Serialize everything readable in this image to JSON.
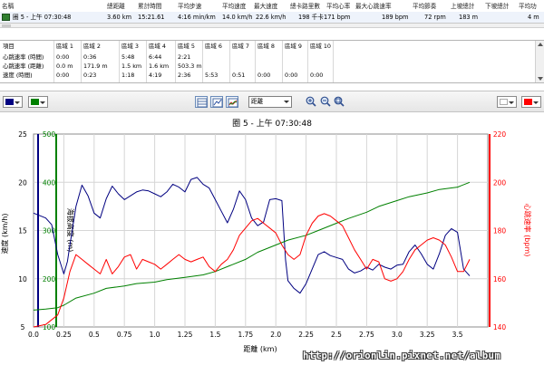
{
  "laps_table": {
    "headers": [
      "名稱",
      "總距離",
      "累計時間",
      "平均步速",
      "平均速度",
      "最大速度",
      "總卡路里數",
      "平均心率",
      "最大心跳速率",
      "平均節奏",
      "上坡總計",
      "平均功"
    ],
    "row": [
      "圈 5 - 上午 07:30:48",
      "3.60 km",
      "15:21.61",
      "4:16 min/km",
      "14.0 km/h",
      "22.6 km/h",
      "198 千卡",
      "171 bpm",
      "189 bpm",
      "72 rpm",
      "183 m",
      "4 m"
    ],
    "extra_header": "下坡總計"
  },
  "zones_table": {
    "headers": [
      "項目",
      "區域 1",
      "區域 2",
      "區域 3",
      "區域 4",
      "區域 5",
      "區域 6",
      "區域 7",
      "區域 8",
      "區域 9",
      "區域 10"
    ],
    "rows": [
      [
        "心跳速率 (時間)",
        "0:00",
        "0:36",
        "5:48",
        "6:44",
        "2:21",
        "",
        "",
        "",
        "",
        ""
      ],
      [
        "心跳速率 (距離)",
        "0.0 m",
        "171.9 m",
        "1.5 km",
        "1.6 km",
        "503.3 m",
        "",
        "",
        "",
        "",
        ""
      ],
      [
        "速度 (時間)",
        "0:00",
        "0:23",
        "1:18",
        "4:19",
        "2:36",
        "5:53",
        "0:51",
        "0:00",
        "0:00",
        "0:00"
      ]
    ]
  },
  "toolbar": {
    "left_color_1": "#000080",
    "left_color_2": "#008000",
    "x_axis_select": "距離",
    "right_color_1": "#ffffff",
    "right_color_2": "#ff0000",
    "icons": [
      "chart-view-icon",
      "line-view-icon",
      "combined-view-icon",
      "zoom-in-icon",
      "zoom-out-icon",
      "zoom-reset-icon"
    ]
  },
  "watermark": "http://orionlin.pixnet.net/album",
  "chart_data": {
    "type": "line",
    "title": "圈 5 - 上午 07:30:48",
    "xlabel": "距離 (km)",
    "x_ticks": [
      "0.0",
      "0.25",
      "0.5",
      "0.75",
      "1.0",
      "1.25",
      "1.5",
      "1.75",
      "2.0",
      "2.25",
      "2.5",
      "2.75",
      "3.0",
      "3.25",
      "3.5"
    ],
    "xlim": [
      0,
      3.75
    ],
    "axes": {
      "speed": {
        "label": "速度 (km/h)",
        "ticks": [
          5,
          10,
          15,
          20,
          25
        ],
        "ylim": [
          5,
          25
        ],
        "color": "#000080"
      },
      "elevation": {
        "label": "海拔高度 (m)",
        "ticks": [
          100,
          200,
          300,
          400,
          500
        ],
        "ylim": [
          100,
          500
        ],
        "color": "#008000"
      },
      "heart_rate": {
        "label": "心跳速率 (bpm)",
        "ticks": [
          140,
          160,
          180,
          200,
          220
        ],
        "ylim": [
          140,
          220
        ],
        "color": "#ff0000"
      }
    },
    "grid": true,
    "series": [
      {
        "name": "速度",
        "axis": "speed",
        "color": "#000080",
        "x": [
          0,
          0.1,
          0.15,
          0.2,
          0.25,
          0.28,
          0.3,
          0.35,
          0.4,
          0.45,
          0.5,
          0.55,
          0.6,
          0.65,
          0.7,
          0.75,
          0.8,
          0.85,
          0.9,
          0.95,
          1.0,
          1.05,
          1.1,
          1.15,
          1.2,
          1.25,
          1.3,
          1.35,
          1.4,
          1.45,
          1.5,
          1.55,
          1.6,
          1.65,
          1.7,
          1.75,
          1.8,
          1.85,
          1.9,
          1.95,
          2.0,
          2.05,
          2.08,
          2.1,
          2.15,
          2.2,
          2.25,
          2.3,
          2.35,
          2.4,
          2.45,
          2.5,
          2.55,
          2.6,
          2.65,
          2.7,
          2.75,
          2.8,
          2.85,
          2.9,
          2.95,
          3.0,
          3.05,
          3.1,
          3.15,
          3.2,
          3.25,
          3.3,
          3.35,
          3.4,
          3.45,
          3.5,
          3.55,
          3.6
        ],
        "y": [
          16.8,
          16.3,
          15.6,
          12.5,
          10.5,
          11.8,
          13.5,
          17.5,
          19.7,
          18.6,
          16.8,
          16.3,
          18.3,
          19.6,
          18.8,
          18.2,
          18.6,
          19.0,
          19.2,
          19.1,
          18.8,
          18.5,
          19.0,
          19.8,
          19.5,
          19.0,
          20.3,
          20.5,
          19.8,
          19.4,
          18.2,
          17.0,
          15.8,
          17.2,
          19.1,
          18.2,
          16.3,
          15.5,
          15.9,
          18.2,
          18.3,
          18.1,
          12.0,
          9.8,
          9.0,
          8.5,
          9.5,
          11.0,
          12.5,
          12.8,
          12.4,
          12.2,
          12.0,
          11.0,
          10.6,
          10.8,
          11.2,
          10.9,
          11.5,
          11.2,
          11.0,
          11.4,
          11.5,
          12.8,
          13.5,
          12.6,
          11.5,
          11.0,
          12.6,
          14.5,
          15.2,
          14.8,
          11.0,
          10.3
        ]
      },
      {
        "name": "海拔高度",
        "axis": "elevation",
        "color": "#008000",
        "x": [
          0,
          0.1,
          0.2,
          0.25,
          0.35,
          0.5,
          0.6,
          0.75,
          0.85,
          1.0,
          1.1,
          1.25,
          1.4,
          1.5,
          1.6,
          1.75,
          1.85,
          2.0,
          2.1,
          2.25,
          2.35,
          2.5,
          2.6,
          2.75,
          2.85,
          3.0,
          3.1,
          3.25,
          3.35,
          3.5,
          3.6
        ],
        "y": [
          135,
          137,
          140,
          145,
          160,
          170,
          180,
          185,
          190,
          193,
          198,
          203,
          208,
          215,
          225,
          240,
          255,
          270,
          280,
          290,
          300,
          315,
          325,
          338,
          350,
          362,
          370,
          378,
          385,
          390,
          400
        ]
      },
      {
        "name": "心跳速率",
        "axis": "heart_rate",
        "color": "#ff0000",
        "x": [
          0,
          0.1,
          0.2,
          0.25,
          0.3,
          0.35,
          0.4,
          0.45,
          0.5,
          0.55,
          0.6,
          0.65,
          0.7,
          0.75,
          0.8,
          0.85,
          0.9,
          0.95,
          1.0,
          1.05,
          1.1,
          1.15,
          1.2,
          1.25,
          1.3,
          1.35,
          1.4,
          1.45,
          1.5,
          1.55,
          1.6,
          1.65,
          1.7,
          1.75,
          1.8,
          1.85,
          1.9,
          1.95,
          2.0,
          2.05,
          2.1,
          2.15,
          2.2,
          2.25,
          2.3,
          2.35,
          2.4,
          2.45,
          2.5,
          2.55,
          2.6,
          2.65,
          2.7,
          2.75,
          2.8,
          2.85,
          2.9,
          2.95,
          3.0,
          3.05,
          3.1,
          3.15,
          3.2,
          3.25,
          3.3,
          3.35,
          3.4,
          3.45,
          3.5,
          3.55,
          3.6
        ],
        "y": [
          140,
          141,
          145,
          152,
          163,
          170,
          168,
          166,
          164,
          162,
          168,
          162,
          165,
          169,
          170,
          164,
          168,
          167,
          166,
          164,
          166,
          168,
          170,
          168,
          167,
          168,
          169,
          165,
          163,
          166,
          168,
          172,
          178,
          181,
          184,
          185,
          183,
          181,
          179,
          174,
          170,
          168,
          170,
          178,
          183,
          186,
          187,
          186,
          184,
          182,
          177,
          172,
          168,
          164,
          168,
          167,
          160,
          159,
          160,
          163,
          168,
          172,
          174,
          176,
          177,
          176,
          174,
          169,
          163,
          163,
          168
        ]
      }
    ]
  }
}
